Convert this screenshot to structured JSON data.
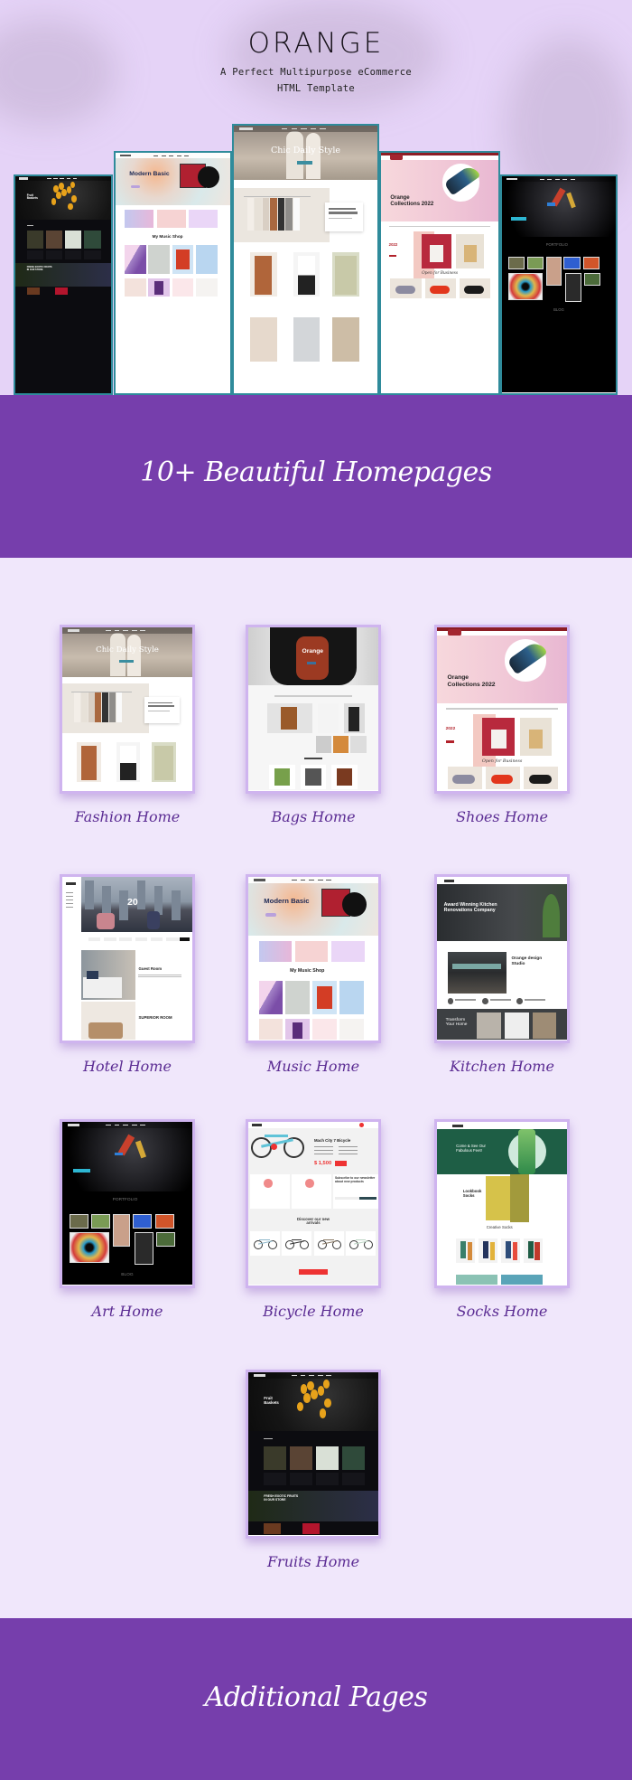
{
  "header": {
    "logo": "ORANGE",
    "subtitle_line1": "A Perfect Multipurpose eCommerce",
    "subtitle_line2": "HTML Template"
  },
  "colors": {
    "band_purple": "#763eac",
    "page_lavender": "#f0e7fb",
    "hero_lavender": "#e5d3f7",
    "label_purple": "#5b2c93",
    "showcase_border": "#2f8b9b",
    "card_border": "#cfb4ef"
  },
  "sections": {
    "homepages_title": "10+ Beautiful Homepages",
    "additional_title": "Additional Pages"
  },
  "showcase": [
    "fruits",
    "music",
    "fashion",
    "shoes",
    "art"
  ],
  "homepages": [
    {
      "label": "Fashion Home",
      "kind": "fashion"
    },
    {
      "label": "Bags Home",
      "kind": "bags"
    },
    {
      "label": "Shoes Home",
      "kind": "shoes"
    },
    {
      "label": "Hotel Home",
      "kind": "hotel"
    },
    {
      "label": "Music Home",
      "kind": "music"
    },
    {
      "label": "Kitchen Home",
      "kind": "kitchen"
    },
    {
      "label": "Art Home",
      "kind": "art"
    },
    {
      "label": "Bicycle Home",
      "kind": "bicycle"
    },
    {
      "label": "Socks Home",
      "kind": "socks"
    },
    {
      "label": "Fruits Home",
      "kind": "fruits"
    }
  ],
  "mock": {
    "fashion": {
      "hero": "Chic Daily Style"
    },
    "bags": {
      "hero": "Orange"
    },
    "shoes": {
      "hero_line1": "Orange",
      "hero_line2": "Collections 2022",
      "tag": "2022",
      "section": "Open for Business"
    },
    "hotel": {
      "hero": "20",
      "room1": "Guest Room",
      "room2": "SUPERIOR ROOM"
    },
    "music": {
      "hero": "Modern Basic",
      "section": "My Music Shop"
    },
    "kitchen": {
      "hero": "Award Winning Kitchen Renovations Company",
      "studio": "Orange design Studio",
      "footer": "Transform Your Home"
    },
    "art": {
      "portfolio": "PORTFOLIO",
      "blog": "BLOG"
    },
    "bicycle": {
      "title": "Mach City 7 Bicycle",
      "price": "$ 1,500",
      "newsletter": "Subscribe to our newsletter about new products",
      "arrivals": "Discover our new arrivals"
    },
    "socks": {
      "hero": "Come & See Our Fabulous Feet!",
      "lookbook": "Lookbook Socks",
      "section": "Creative Socks"
    },
    "fruits": {
      "hero": "Fruit Baskets",
      "banner": "FRESH EXOTIC FRUITS IN OUR STORE"
    }
  }
}
